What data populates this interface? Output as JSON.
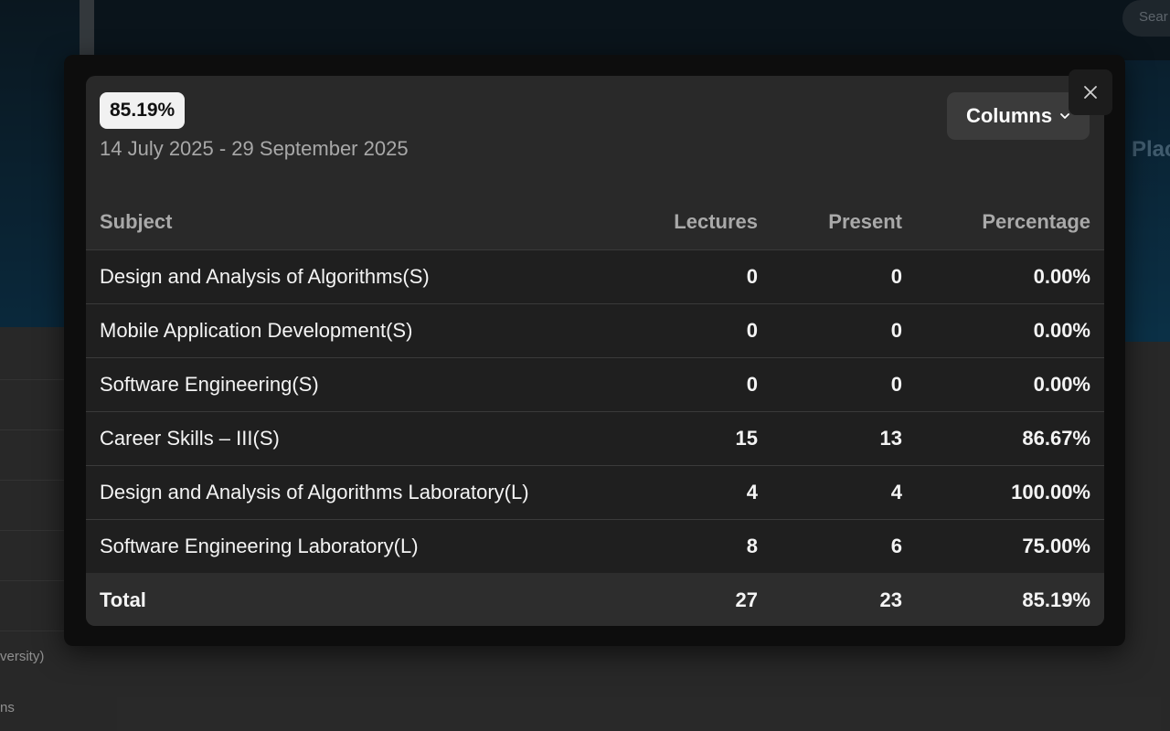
{
  "background": {
    "search_placeholder": "Sear",
    "banner_fragment": "Plac",
    "sidebar_fragment_1": "versity)",
    "sidebar_fragment_2": "ns"
  },
  "modal": {
    "badge": "85.19%",
    "date_range": "14 July 2025 - 29 September 2025",
    "columns_label": "Columns",
    "close_icon": "close-icon",
    "table": {
      "headers": [
        "Subject",
        "Lectures",
        "Present",
        "Percentage"
      ],
      "rows": [
        {
          "subject": "Design and Analysis of Algorithms(S)",
          "lectures": "0",
          "present": "0",
          "percentage": "0.00%"
        },
        {
          "subject": "Mobile Application Development(S)",
          "lectures": "0",
          "present": "0",
          "percentage": "0.00%"
        },
        {
          "subject": "Software Engineering(S)",
          "lectures": "0",
          "present": "0",
          "percentage": "0.00%"
        },
        {
          "subject": "Career Skills – III(S)",
          "lectures": "15",
          "present": "13",
          "percentage": "86.67%"
        },
        {
          "subject": "Design and Analysis of Algorithms Laboratory(L)",
          "lectures": "4",
          "present": "4",
          "percentage": "100.00%"
        },
        {
          "subject": "Software Engineering Laboratory(L)",
          "lectures": "8",
          "present": "6",
          "percentage": "75.00%"
        }
      ],
      "total": {
        "subject": "Total",
        "lectures": "27",
        "present": "23",
        "percentage": "85.19%"
      }
    }
  }
}
